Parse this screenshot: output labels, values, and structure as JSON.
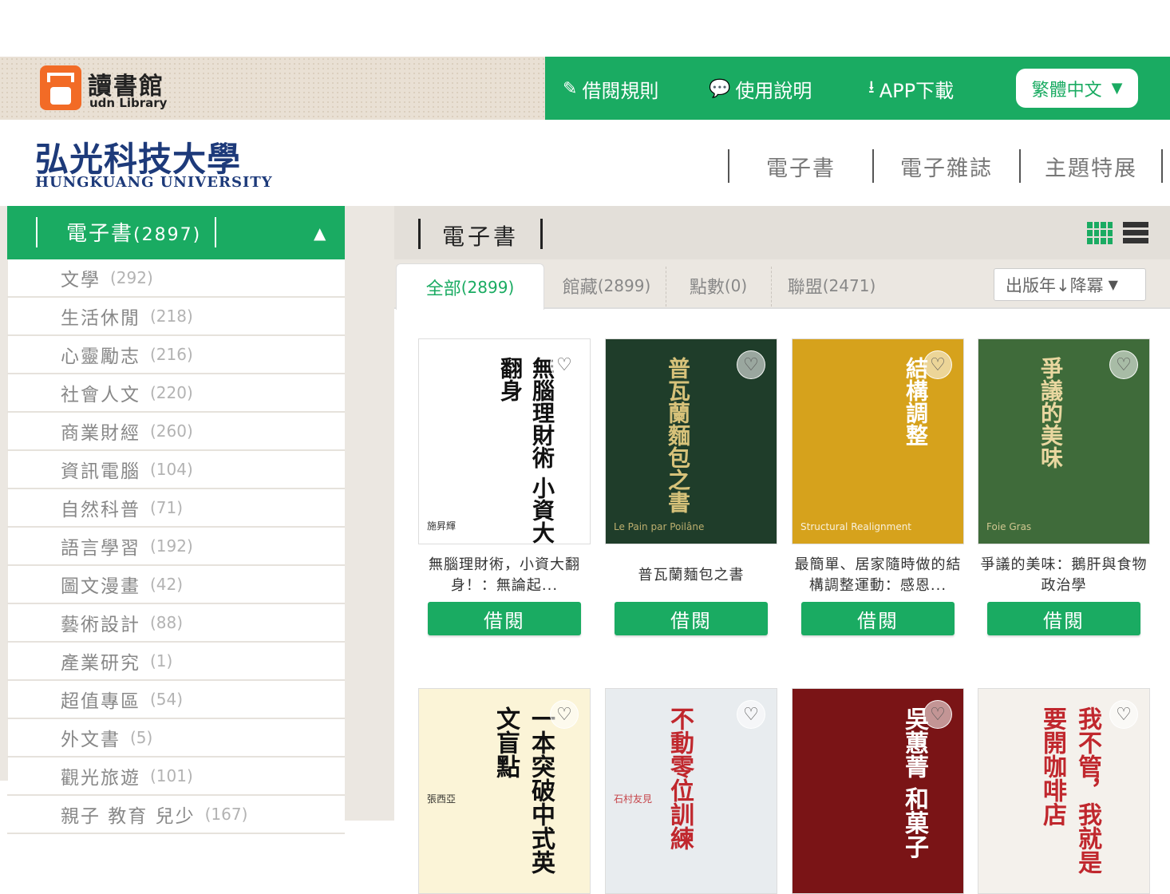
{
  "header": {
    "logo_title": "讀書館",
    "logo_subtitle": "udn Library",
    "nav": [
      {
        "icon": "edit-icon",
        "label": "借閱規則"
      },
      {
        "icon": "chat-icon",
        "label": "使用說明"
      },
      {
        "icon": "download-icon",
        "label": "APP下載"
      }
    ],
    "language": "繁體中文"
  },
  "school": {
    "name_cn": "弘光科技大學",
    "name_en": "HUNGKUANG UNIVERSITY"
  },
  "main_nav": [
    "電子書",
    "電子雜誌",
    "主題特展"
  ],
  "sidebar": {
    "heading": "電子書",
    "heading_count": "(2897)",
    "categories": [
      {
        "name": "文學",
        "count": "(292)"
      },
      {
        "name": "生活休閒",
        "count": "(218)"
      },
      {
        "name": "心靈勵志",
        "count": "(216)"
      },
      {
        "name": "社會人文",
        "count": "(220)"
      },
      {
        "name": "商業財經",
        "count": "(260)"
      },
      {
        "name": "資訊電腦",
        "count": "(104)"
      },
      {
        "name": "自然科普",
        "count": "(71)"
      },
      {
        "name": "語言學習",
        "count": "(192)"
      },
      {
        "name": "圖文漫畫",
        "count": "(42)"
      },
      {
        "name": "藝術設計",
        "count": "(88)"
      },
      {
        "name": "產業研究",
        "count": "(1)"
      },
      {
        "name": "超值專區",
        "count": "(54)"
      },
      {
        "name": "外文書",
        "count": "(5)"
      },
      {
        "name": "觀光旅遊",
        "count": "(101)"
      },
      {
        "name": "親子 教育 兒少",
        "count": "(167)"
      }
    ]
  },
  "content": {
    "heading": "電子書",
    "tabs": [
      {
        "label": "全部",
        "count": "(2899)"
      },
      {
        "label": "館藏",
        "count": "(2899)"
      },
      {
        "label": "點數",
        "count": "(0)"
      },
      {
        "label": "聯盟",
        "count": "(2471)"
      }
    ],
    "sort": "出版年↓降冪",
    "borrow_label": "借閱",
    "books": [
      {
        "title": "無腦理財術，小資大翻身！：無論起...",
        "cover_text": "無腦理財術 小資大翻身",
        "cover_author": "施昇輝",
        "cover_bg": "#ffffff",
        "cover_fg": "#111111"
      },
      {
        "title": "普瓦蘭麵包之書",
        "cover_text": "普瓦蘭麵包之書",
        "cover_author": "Le Pain par Poilâne",
        "cover_bg": "#1f3d2a",
        "cover_fg": "#d7c27a"
      },
      {
        "title": "最簡單、居家隨時做的結構調整運動：感恩...",
        "cover_text": "結構調整",
        "cover_author": "Structural Realignment",
        "cover_bg": "#d6a21c",
        "cover_fg": "#ffffff"
      },
      {
        "title": "爭議的美味：鵝肝與食物政治學",
        "cover_text": "爭議的美味",
        "cover_author": "Foie Gras",
        "cover_bg": "#3f6b3a",
        "cover_fg": "#e9d7a0"
      },
      {
        "title": "",
        "cover_text": "一本突破中式英文盲點",
        "cover_author": "張西亞",
        "cover_bg": "#fbf4d7",
        "cover_fg": "#111111"
      },
      {
        "title": "",
        "cover_text": "不動零位訓練",
        "cover_author": "石村友見",
        "cover_bg": "#e8ecef",
        "cover_fg": "#c0272d"
      },
      {
        "title": "",
        "cover_text": "吳蕙菁 和菓子",
        "cover_author": "",
        "cover_bg": "#7a1416",
        "cover_fg": "#ffffff"
      },
      {
        "title": "",
        "cover_text": "我不管，我就是要開咖啡店",
        "cover_author": "",
        "cover_bg": "#f4f1ec",
        "cover_fg": "#c0272d"
      }
    ]
  }
}
